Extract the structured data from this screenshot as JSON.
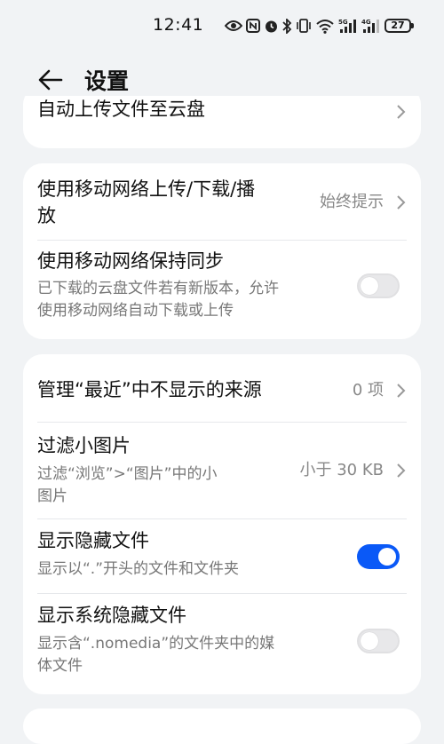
{
  "status_bar": {
    "time": "12:41",
    "battery": "27"
  },
  "header": {
    "title": "设置"
  },
  "card0": {
    "partial_label": "自动上传文件至云盘"
  },
  "mobile_network": {
    "upload_download": {
      "label_line1": "使用移动网络上传/下载/播",
      "label_line2": "放",
      "value": "始终提示"
    },
    "keep_sync": {
      "label": "使用移动网络保持同步",
      "desc_line1": "已下载的云盘文件若有新版本，允许",
      "desc_line2": "使用移动网络自动下载或上传",
      "enabled": false
    }
  },
  "display": {
    "recent_sources": {
      "label": "管理“最近”中不显示的来源",
      "value": "0 项"
    },
    "filter_small": {
      "label": "过滤小图片",
      "desc_line1": "过滤“浏览”>“图片”中的小",
      "desc_line2": "图片",
      "value": "小于 30 KB"
    },
    "hidden_files": {
      "label": "显示隐藏文件",
      "desc": "显示以“.”开头的文件和文件夹",
      "enabled": true
    },
    "system_hidden": {
      "label": "显示系统隐藏文件",
      "desc_line1": "显示含“.nomedia”的文件夹中的媒",
      "desc_line2": "体文件",
      "enabled": false
    }
  },
  "colors": {
    "accent": "#0a59f7",
    "background": "#f1f3f5",
    "card": "#ffffff"
  }
}
